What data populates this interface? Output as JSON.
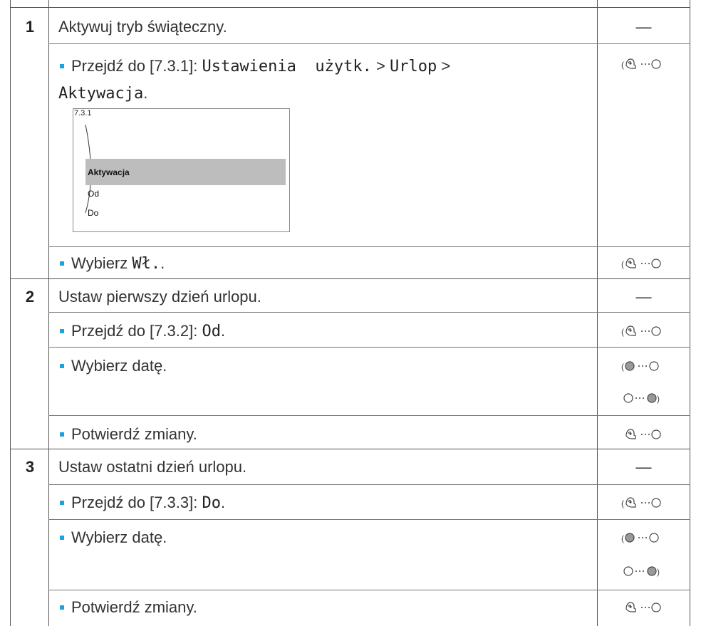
{
  "steps": [
    {
      "number": "1",
      "title": "Aktywuj tryb świąteczny.",
      "title_icon": "—",
      "substeps": [
        {
          "prefix": "Przejdź do [7.3.1]:",
          "path": [
            "Ustawienia  użytk.",
            "Urlop",
            "Aktywacja"
          ],
          "separator": ">",
          "icon": "turn-press-left-dial-icon",
          "screen": {
            "code": "7.3.1",
            "selected": "Aktywacja",
            "options": [
              "Od",
              "Do"
            ]
          }
        },
        {
          "prefix": "Wybierz",
          "value": "Wł.",
          "suffix": ".",
          "icon": "turn-press-left-dial-icon"
        }
      ]
    },
    {
      "number": "2",
      "title": "Ustaw pierwszy dzień urlopu.",
      "title_icon": "—",
      "substeps": [
        {
          "prefix": "Przejdź do [7.3.2]:",
          "value": "Od",
          "suffix": ".",
          "icon": "turn-press-left-dial-icon"
        },
        {
          "text": "Wybierz datę.",
          "icons": [
            "turn-left-dial-icon",
            "turn-right-dial-icon"
          ]
        },
        {
          "text": "Potwierdź zmiany.",
          "icon": "press-left-dial-icon"
        }
      ]
    },
    {
      "number": "3",
      "title": "Ustaw ostatni dzień urlopu.",
      "title_icon": "—",
      "substeps": [
        {
          "prefix": "Przejdź do [7.3.3]:",
          "value": "Do",
          "suffix": ".",
          "icon": "turn-press-left-dial-icon"
        },
        {
          "text": "Wybierz datę.",
          "icons": [
            "turn-left-dial-icon",
            "turn-right-dial-icon"
          ]
        },
        {
          "text": "Potwierdź zmiany.",
          "icon": "press-left-dial-icon"
        }
      ]
    }
  ]
}
